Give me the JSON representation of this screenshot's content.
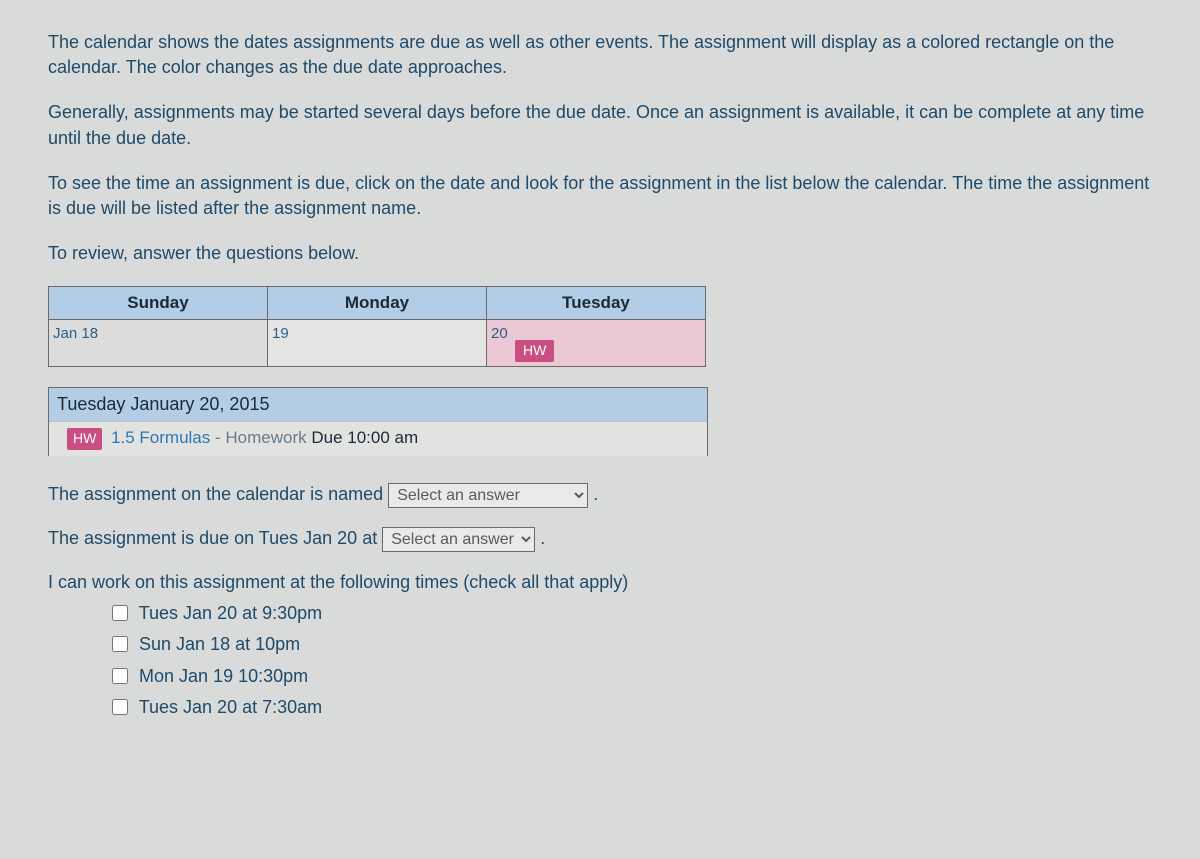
{
  "paragraphs": {
    "p1": "The calendar shows the dates assignments are due as well as other events. The assignment will display as a colored rectangle on the calendar. The color changes as the due date approaches.",
    "p2": "Generally, assignments may be started several days before the due date. Once an assignment is available, it can be complete at any time until the due date.",
    "p3": "To see the time an assignment is due, click on the date and look for the assignment in the list below the calendar. The time the assignment is due will be listed after the assignment name.",
    "p4": "To review, answer the questions below."
  },
  "calendar": {
    "headers": {
      "sun": "Sunday",
      "mon": "Monday",
      "tue": "Tuesday"
    },
    "days": {
      "sun": "Jan 18",
      "mon": "19",
      "tue": "20"
    },
    "hw_badge": "HW"
  },
  "detail": {
    "header": "Tuesday January 20, 2015",
    "hw_mini": "HW",
    "assignment_link": "1.5 Formulas",
    "assignment_type": " - Homework ",
    "assignment_due": "Due 10:00 am"
  },
  "q1": {
    "pre": "The assignment on the calendar is named ",
    "placeholder": "Select an answer",
    "post": " ."
  },
  "q2": {
    "pre": "The assignment is due on Tues Jan 20 at ",
    "placeholder": "Select an answer",
    "post": " ."
  },
  "q3": {
    "prompt": "I can work on this assignment at the following times (check all that apply)",
    "opts": {
      "a": "Tues Jan 20 at 9:30pm",
      "b": "Sun Jan 18 at 10pm",
      "c": "Mon Jan 19 10:30pm",
      "d": "Tues Jan 20 at 7:30am"
    }
  }
}
